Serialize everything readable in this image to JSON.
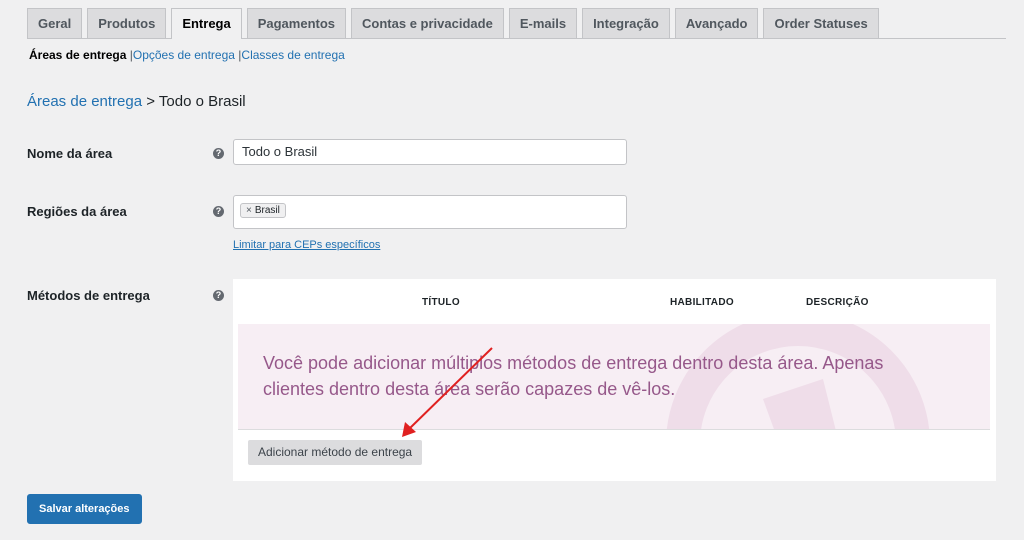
{
  "tabs": [
    {
      "label": "Geral"
    },
    {
      "label": "Produtos"
    },
    {
      "label": "Entrega",
      "active": true
    },
    {
      "label": "Pagamentos"
    },
    {
      "label": "Contas e privacidade"
    },
    {
      "label": "E-mails"
    },
    {
      "label": "Integração"
    },
    {
      "label": "Avançado"
    },
    {
      "label": "Order Statuses"
    }
  ],
  "subnav": {
    "current": "Áreas de entrega",
    "options": "Opções de entrega",
    "classes": "Classes de entrega",
    "separator": "|"
  },
  "heading": {
    "link": "Áreas de entrega",
    "separator": ">",
    "zone": "Todo o Brasil"
  },
  "fields": {
    "zone_name": {
      "label": "Nome da área",
      "value": "Todo o Brasil"
    },
    "zone_regions": {
      "label": "Regiões da área",
      "chip": "Brasil",
      "chip_remove": "×",
      "limit_link": "Limitar para CEPs específicos"
    },
    "shipping_methods": {
      "label": "Métodos de entrega"
    }
  },
  "methods_table": {
    "columns": [
      "TÍTULO",
      "HABILITADO",
      "DESCRIÇÃO"
    ],
    "empty_message": "Você pode adicionar múltiplos métodos de entrega dentro desta área. Apenas clientes dentro desta área serão capazes de vê-los.",
    "add_button": "Adicionar método de entrega"
  },
  "help_icon_glyph": "?",
  "save_button": "Salvar alterações",
  "colors": {
    "primary": "#2271b1",
    "woo_purple": "#96588a",
    "annotation_arrow": "#e02020"
  }
}
